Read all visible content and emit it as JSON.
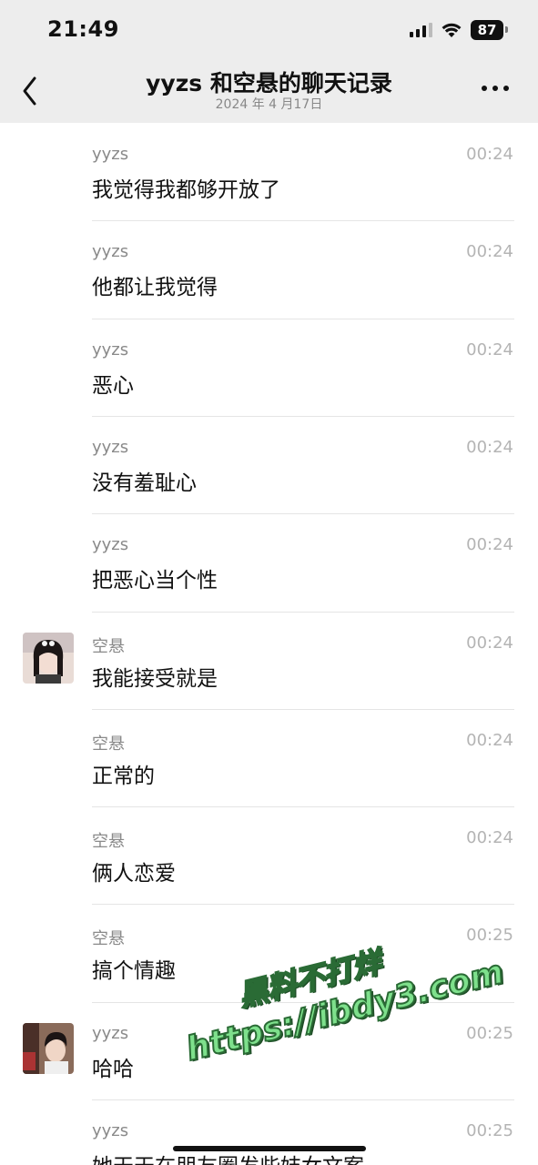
{
  "status_bar": {
    "time": "21:49",
    "battery": "87"
  },
  "nav": {
    "title": "yyzs 和空悬的聊天记录",
    "date": "2024 年 4 月17日"
  },
  "messages": [
    {
      "sender": "yyzs",
      "time": "00:24",
      "text": "我觉得我都够开放了",
      "avatar": ""
    },
    {
      "sender": "yyzs",
      "time": "00:24",
      "text": "他都让我觉得",
      "avatar": ""
    },
    {
      "sender": "yyzs",
      "time": "00:24",
      "text": "恶心",
      "avatar": ""
    },
    {
      "sender": "yyzs",
      "time": "00:24",
      "text": "没有羞耻心",
      "avatar": ""
    },
    {
      "sender": "yyzs",
      "time": "00:24",
      "text": "把恶心当个性",
      "avatar": ""
    },
    {
      "sender": "空悬",
      "time": "00:24",
      "text": "我能接受就是",
      "avatar": "girl"
    },
    {
      "sender": "空悬",
      "time": "00:24",
      "text": "正常的",
      "avatar": ""
    },
    {
      "sender": "空悬",
      "time": "00:24",
      "text": "俩人恋爱",
      "avatar": ""
    },
    {
      "sender": "空悬",
      "time": "00:25",
      "text": "搞个情趣",
      "avatar": ""
    },
    {
      "sender": "yyzs",
      "time": "00:25",
      "text": "哈哈",
      "avatar": "boy"
    },
    {
      "sender": "yyzs",
      "time": "00:25",
      "text": "她天天在朋友圈发些妓女文案",
      "avatar": ""
    }
  ],
  "watermark": {
    "line1": "黑料不打烊",
    "line2": "https://ibdy3.com"
  },
  "colors": {
    "header_bg": "#ededed",
    "divider": "#e5e5e5",
    "sender": "#8a8a8a",
    "time": "#b4b4b4",
    "watermark": "#7ee08c"
  },
  "icons": [
    "back-chevron-icon",
    "more-dots-icon",
    "signal-icon",
    "wifi-icon",
    "battery-icon"
  ]
}
